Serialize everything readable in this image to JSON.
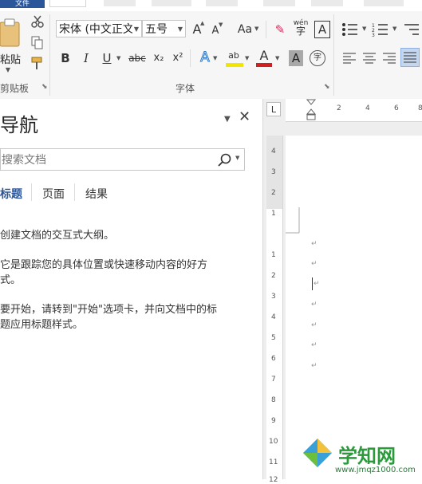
{
  "ribbon": {
    "file_tab": "文件",
    "font_name": "宋体 (中文正文",
    "font_size": "五号",
    "paste_label": "粘贴",
    "clipboard_group": "剪贴板",
    "font_group": "字体",
    "icons": [
      "cut-icon",
      "copy-icon",
      "format-painter-icon",
      "grow-font-icon",
      "shrink-font-icon",
      "change-case-icon",
      "clear-format-icon",
      "phonetic-guide-icon",
      "char-border-icon",
      "bold-icon",
      "italic-icon",
      "underline-icon",
      "strikethrough-icon",
      "subscript-icon",
      "superscript-icon",
      "text-effects-icon",
      "highlight-icon",
      "font-color-icon",
      "char-shading-icon",
      "enclose-char-icon",
      "bullets-icon",
      "numbering-icon",
      "align-left-icon",
      "center-icon",
      "align-right-icon",
      "justify-icon"
    ],
    "button_glyphs": {
      "grow": "A",
      "shrink": "A",
      "case": "Aa",
      "clear": "✎",
      "phonetic": "wén",
      "border": "A",
      "bold": "B",
      "italic": "I",
      "underline": "U",
      "strike": "abc",
      "sub": "x₂",
      "sup": "x²",
      "effects": "A",
      "highlight": "ab",
      "fontcolor": "A",
      "shading": "A",
      "enclose": "字"
    },
    "highlight_color": "#f2e600",
    "font_color": "#d02020",
    "accent_color": "#2b579a"
  },
  "nav": {
    "title": "导航",
    "search_placeholder": "搜索文档",
    "tabs": [
      "标题",
      "页面",
      "结果"
    ],
    "active_tab": 0,
    "body_lines": [
      "创建文档的交互式大纲。",
      "它是跟踪您的具体位置或快速移动内容的好方",
      "式。",
      "要开始，请转到\"开始\"选项卡，并向文档中的标",
      "题应用标题样式。"
    ]
  },
  "ruler": {
    "tab_marker": "L",
    "horizontal": [
      "2",
      "4",
      "6",
      "8"
    ],
    "vertical_top": [
      "4",
      "3",
      "2",
      "1"
    ],
    "vertical_bottom": [
      "1",
      "2",
      "3",
      "4",
      "5",
      "6",
      "7",
      "8",
      "9",
      "10",
      "11",
      "12"
    ]
  },
  "watermark": {
    "text": "学知网",
    "url": "www.jmqz1000.com"
  }
}
